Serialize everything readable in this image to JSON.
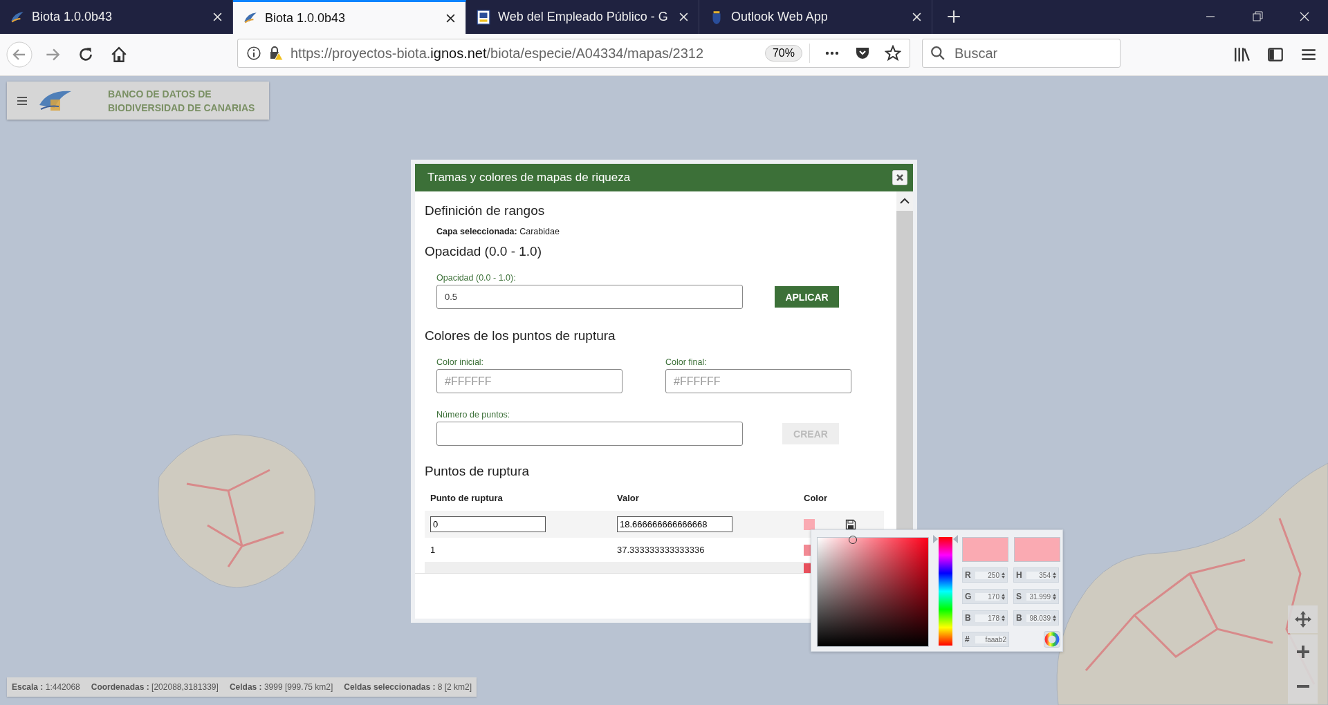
{
  "browser": {
    "tabs": [
      {
        "title": "Biota 1.0.0b43",
        "selected": false
      },
      {
        "title": "Biota 1.0.0b43",
        "selected": true
      },
      {
        "title": "Web del Empleado Público - G",
        "selected": false
      },
      {
        "title": "Outlook Web App",
        "selected": false
      }
    ],
    "url": {
      "start": "https://proyectos-biota.",
      "domain": "ignos.net",
      "path": "/biota/especie/A04334/mapas/2312"
    },
    "zoom": "70%",
    "search": {
      "placeholder": "Buscar"
    }
  },
  "header": {
    "title_lines": [
      "BANCO DE DATOS DE",
      "BIODIVERSIDAD DE CANARIAS"
    ]
  },
  "dialog": {
    "title": "Tramas y colores de mapas de riqueza",
    "section_ranges": "Definición de rangos",
    "layer_label": "Capa seleccionada:",
    "layer_value": "Carabidae",
    "section_opacity": "Opacidad (0.0 - 1.0)",
    "opacity_field": {
      "label": "Opacidad (0.0 - 1.0):",
      "value": "0.5"
    },
    "apply_button": {
      "label": "APLICAR",
      "disabled": false
    },
    "section_colors": "Colores de los puntos de ruptura",
    "start_color": {
      "label": "Color inicial:",
      "placeholder": "#FFFFFF"
    },
    "end_color": {
      "label": "Color final:",
      "placeholder": "#FFFFFF"
    },
    "points_field": {
      "label": "Número de puntos:"
    },
    "create_button": {
      "label": "CREAR",
      "disabled": true
    },
    "section_points": "Puntos de ruptura",
    "table": {
      "columns": [
        "Punto de ruptura",
        "Valor",
        "Color"
      ],
      "rows": [
        {
          "kind": "edit",
          "point": "0",
          "value": "18.666666666666668",
          "color": "#faaab2"
        },
        {
          "kind": "plain",
          "point": "1",
          "value": "37.333333333333336",
          "color": "#f28a94"
        },
        {
          "kind": "cut",
          "color": "#e8505c"
        }
      ]
    }
  },
  "color_picker": {
    "hue": {
      "level": 0.983
    },
    "fields": [
      {
        "label": "R",
        "value": "250"
      },
      {
        "label": "H",
        "value": "354"
      },
      {
        "label": "G",
        "value": "170"
      },
      {
        "label": "S",
        "value": "31.999"
      },
      {
        "label": "B",
        "value": "178"
      },
      {
        "label": "B",
        "value": "98.039"
      }
    ],
    "hex": {
      "label": "#",
      "value": "faaab2"
    }
  },
  "status_bar": [
    {
      "label": "Escala :",
      "value": "1:442068"
    },
    {
      "label": "Coordenadas :",
      "value": "[202088,3181339]"
    },
    {
      "label": "Celdas :",
      "value": "3999 [999.75 km2]"
    },
    {
      "label": "Celdas seleccionadas :",
      "value": "8 [2 km2]"
    }
  ]
}
